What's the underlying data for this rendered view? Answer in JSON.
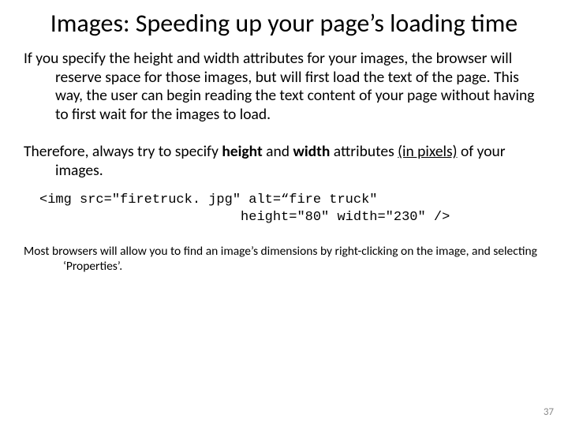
{
  "title": "Images: Speeding up your page’s loading time",
  "para1": {
    "t1": "If you specify the height and width attributes for your images, the browser will reserve space for those images, but will first load the text of the page. This way, the user can begin reading the text content of your page without having to first wait for the images to load."
  },
  "para2": {
    "t1": "Therefore, always try to specify ",
    "b1": "height",
    "t2": " and ",
    "b2": "width",
    "t3": " attributes ",
    "u1": "(in pixels)",
    "t4": " of your images."
  },
  "code": {
    "line1": "<img src=\"firetruck. jpg\" alt=“fire truck\"",
    "line2": "                         height=\"80\" width=\"230\" />"
  },
  "note": "Most browsers will allow you to find an image’s dimensions by right-clicking on the image, and selecting ‘Properties’.",
  "page_number": "37"
}
